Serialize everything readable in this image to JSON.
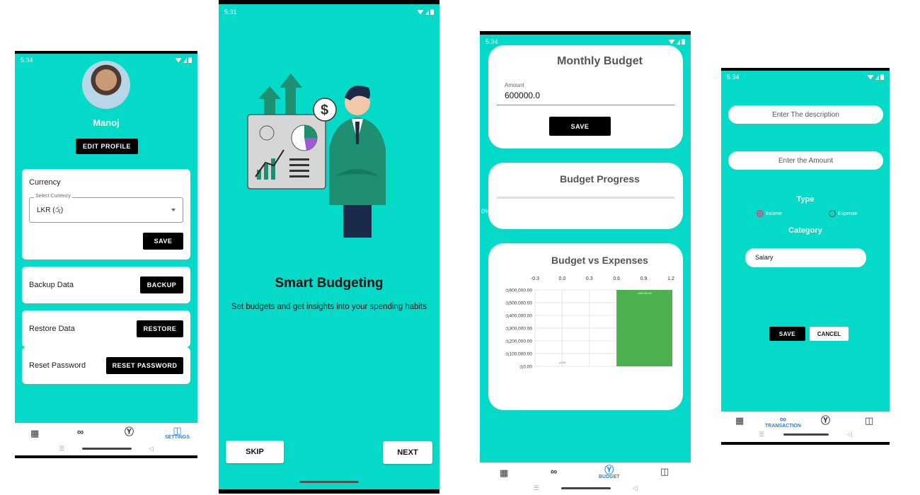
{
  "screen1": {
    "status_time": "5:34",
    "user_name": "Manoj",
    "edit_profile_label": "EDIT PROFILE",
    "currency": {
      "title": "Currency",
      "select_label": "Select Currency",
      "select_value": "LKR (රු)",
      "save_label": "SAVE"
    },
    "backup": {
      "label": "Backup Data",
      "button": "BACKUP"
    },
    "restore": {
      "label": "Restore Data",
      "button": "RESTORE"
    },
    "reset": {
      "label": "Reset Password",
      "button": "RESET PASSWORD"
    },
    "nav": {
      "active_label": "SETTINGS",
      "icons": [
        "store-add-icon",
        "infinity-icon",
        "dollar-circle-icon",
        "settings-phone-icon"
      ]
    }
  },
  "screen2": {
    "status_time": "5:31",
    "title": "Smart Budgeting",
    "subtitle": "Set budgets and get insights into your spending habits",
    "skip_label": "SKIP",
    "next_label": "NEXT"
  },
  "screen3": {
    "status_time": "5:34",
    "monthly_budget": {
      "title": "Monthly Budget",
      "amount_label": "Amount",
      "amount_value": "600000.0",
      "save_label": "SAVE"
    },
    "progress": {
      "title": "Budget Progress",
      "percent_text": "0%",
      "value": 0
    },
    "chart_title": "Budget vs Expenses",
    "nav": {
      "active_label": "BUDGET"
    }
  },
  "screen4": {
    "status_time": "5:34",
    "description_placeholder": "Enter The description",
    "amount_placeholder": "Enter the Amount",
    "type_label": "Type",
    "income_label": "Income",
    "expense_label": "Expense",
    "category_label": "Category",
    "category_value": "Salary",
    "save_label": "SAVE",
    "cancel_label": "CANCEL",
    "nav": {
      "active_label": "TRANSACTION"
    }
  },
  "chart_data": {
    "type": "bar",
    "title": "Budget vs Expenses",
    "orientation": "horizontal-axis-top",
    "x_ticks": [
      "-0.3",
      "0.0",
      "0.3",
      "0.6",
      "0.9",
      "1.2"
    ],
    "y_ticks": [
      "රු600,000.00",
      "රු500,000.00",
      "රු400,000.00",
      "රු300,000.00",
      "රු200,000.00",
      "රු100,000.00",
      "රු0.00"
    ],
    "categories": [
      "0",
      "1"
    ],
    "values": [
      0,
      600000
    ],
    "bar_labels": [
      "රු0.00",
      "රු600,000.00"
    ],
    "ylim": [
      0,
      600000
    ],
    "bar_color": "#4caf50",
    "grid": true
  },
  "colors": {
    "teal": "#05d9c8",
    "accent_blue": "#1e88e5",
    "bar_green": "#4caf50"
  }
}
